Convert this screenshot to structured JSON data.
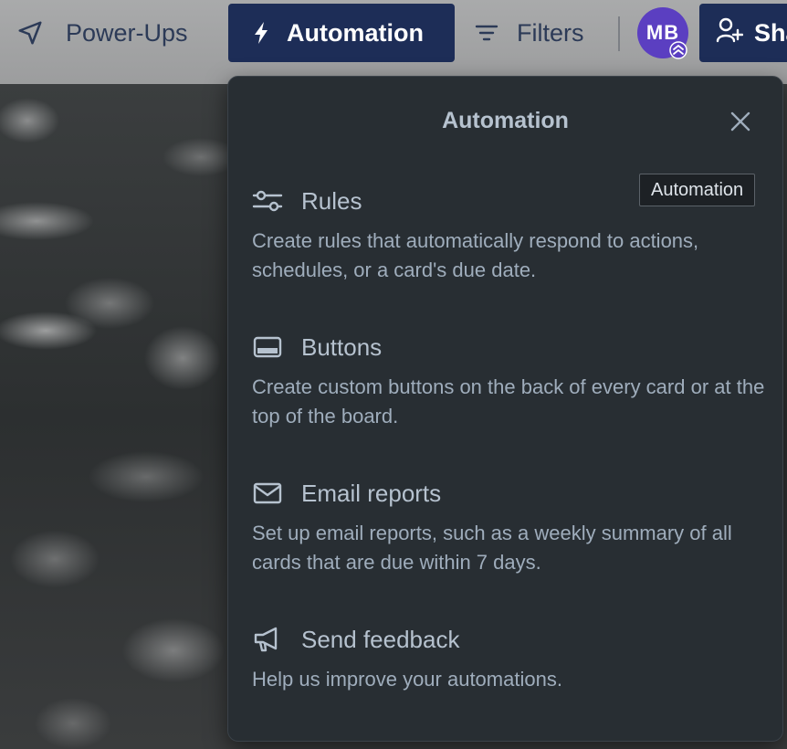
{
  "header": {
    "powerups_label": "Power-Ups",
    "automation_label": "Automation",
    "filters_label": "Filters",
    "avatar_initials": "MB",
    "share_label": "Sha"
  },
  "popover": {
    "title": "Automation",
    "sections": [
      {
        "icon": "sliders-icon",
        "title": "Rules",
        "description": "Create rules that automatically respond to actions, schedules, or a card's due date."
      },
      {
        "icon": "button-icon",
        "title": "Buttons",
        "description": "Create custom buttons on the back of every card or at the top of the board."
      },
      {
        "icon": "email-icon",
        "title": "Email reports",
        "description": "Set up email reports, such as a weekly summary of all cards that are due within 7 days."
      },
      {
        "icon": "megaphone-icon",
        "title": "Send feedback",
        "description": "Help us improve your automations."
      }
    ]
  },
  "tooltip": {
    "text": "Automation"
  },
  "colors": {
    "accent": "#1d2d57",
    "popover_bg": "#282e33",
    "avatar_bg": "#5b3fc1",
    "text_primary": "#b6c2cf",
    "text_secondary": "#9fadbc"
  }
}
